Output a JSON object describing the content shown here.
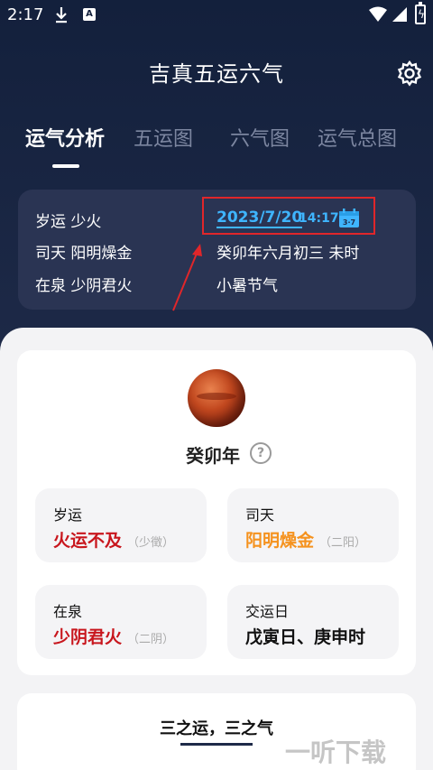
{
  "status_bar": {
    "time": "2:17"
  },
  "header": {
    "title": "吉真五运六气"
  },
  "tabs": [
    {
      "label": "运气分析",
      "active": true
    },
    {
      "label": "五运图",
      "active": false
    },
    {
      "label": "六气图",
      "active": false
    },
    {
      "label": "运气总图",
      "active": false
    }
  ],
  "info": {
    "suiyun": "岁运 少火",
    "sitian": "司天 阳明燥金",
    "zaiquan": "在泉 少阴君火",
    "date": "2023/7/20",
    "time": "14:17",
    "calendar_day": "3·7",
    "lunar": "癸卯年六月初三 未时",
    "solar_term": "小暑节气"
  },
  "summary": {
    "year": "癸卯年",
    "help": "?",
    "cards": [
      {
        "title": "岁运",
        "value": "火运不及",
        "sub": "（少徵）",
        "color": "#c8161d"
      },
      {
        "title": "司天",
        "value": "阳明燥金",
        "sub": "（二阳）",
        "color": "#f5921e"
      },
      {
        "title": "在泉",
        "value": "少阴君火",
        "sub": "（二阴）",
        "color": "#c8161d"
      },
      {
        "title": "交运日",
        "value": "戊寅日、庚申时",
        "sub": "",
        "color": "#111111"
      }
    ]
  },
  "section2": {
    "title": "三之运，三之气"
  },
  "watermark": "一听下载",
  "colors": {
    "accent_blue": "#3fb5ff",
    "highlight_box": "#e0262a",
    "bg_dark": "#1b2540"
  }
}
